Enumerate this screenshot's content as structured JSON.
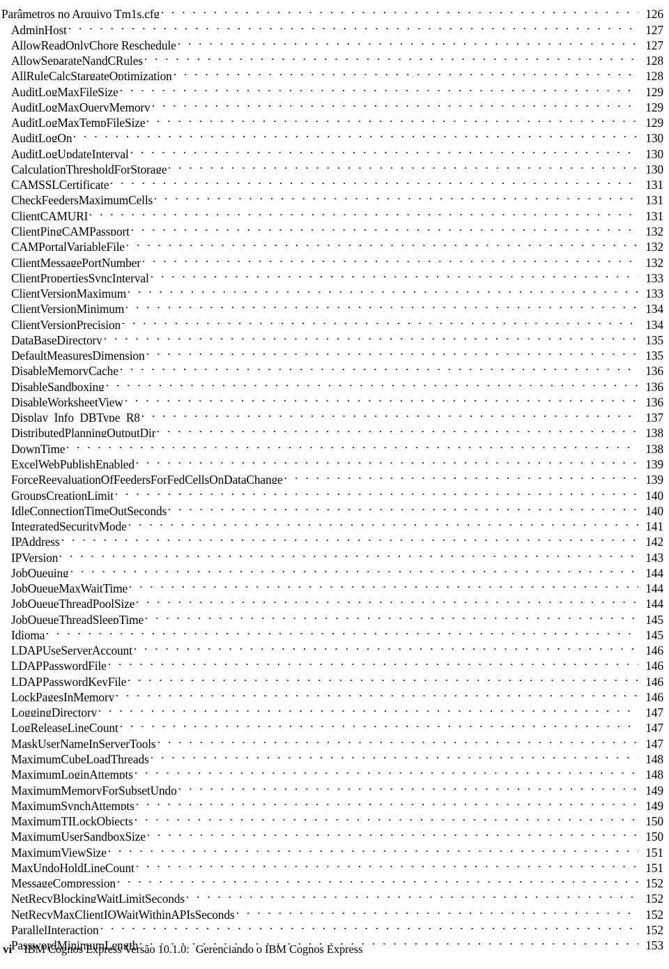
{
  "document": {
    "kind": "table-of-contents",
    "folio": "vi",
    "footer_product": "IBM Cognos Express Versão 10.1.0:",
    "footer_title": "Gerenciando o IBM Cognos Express"
  },
  "toc": {
    "entries": [
      {
        "title": "Parâmetros no Arquivo Tm1s.cfg",
        "page": "126",
        "level": 0
      },
      {
        "title": "AdminHost",
        "page": "127",
        "level": 1
      },
      {
        "title": "AllowReadOnlyChore Reschedule",
        "page": "127",
        "level": 1
      },
      {
        "title": "AllowSeparateNandCRules",
        "page": "128",
        "level": 1
      },
      {
        "title": "AllRuleCalcStargateOptimization",
        "page": "128",
        "level": 1
      },
      {
        "title": "AuditLogMaxFileSize",
        "page": "129",
        "level": 1
      },
      {
        "title": "AuditLogMaxQueryMemory",
        "page": "129",
        "level": 1
      },
      {
        "title": "AuditLogMaxTempFileSize",
        "page": "129",
        "level": 1
      },
      {
        "title": "AuditLogOn",
        "page": "130",
        "level": 1
      },
      {
        "title": "AuditLogUpdateInterval",
        "page": "130",
        "level": 1
      },
      {
        "title": "CalculationThresholdForStorage",
        "page": "130",
        "level": 1
      },
      {
        "title": "CAMSSLCertificate",
        "page": "131",
        "level": 1
      },
      {
        "title": "CheckFeedersMaximumCells",
        "page": "131",
        "level": 1
      },
      {
        "title": "ClientCAMURI",
        "page": "131",
        "level": 1
      },
      {
        "title": "ClientPingCAMPassport",
        "page": "132",
        "level": 1
      },
      {
        "title": "CAMPortalVariableFile",
        "page": "132",
        "level": 1
      },
      {
        "title": "ClientMessagePortNumber",
        "page": "132",
        "level": 1
      },
      {
        "title": "ClientPropertiesSyncInterval",
        "page": "133",
        "level": 1
      },
      {
        "title": "ClientVersionMaximum",
        "page": "133",
        "level": 1
      },
      {
        "title": "ClientVersionMinimum",
        "page": "134",
        "level": 1
      },
      {
        "title": "ClientVersionPrecision",
        "page": "134",
        "level": 1
      },
      {
        "title": "DataBaseDirectory",
        "page": "135",
        "level": 1
      },
      {
        "title": "DefaultMeasuresDimension",
        "page": "135",
        "level": 1
      },
      {
        "title": "DisableMemoryCache",
        "page": "136",
        "level": 1
      },
      {
        "title": "DisableSandboxing",
        "page": "136",
        "level": 1
      },
      {
        "title": "DisableWorksheetView",
        "page": "136",
        "level": 1
      },
      {
        "title": "Display_Info_DBType_R8",
        "page": "137",
        "level": 1
      },
      {
        "title": "DistributedPlanningOutputDir",
        "page": "138",
        "level": 1
      },
      {
        "title": "DownTime",
        "page": "138",
        "level": 1
      },
      {
        "title": "ExcelWebPublishEnabled",
        "page": "139",
        "level": 1
      },
      {
        "title": "ForceReevaluationOfFeedersForFedCellsOnDataChange",
        "page": "139",
        "level": 1
      },
      {
        "title": "GroupsCreationLimit",
        "page": "140",
        "level": 1
      },
      {
        "title": "IdleConnectionTimeOutSeconds",
        "page": "140",
        "level": 1
      },
      {
        "title": "IntegratedSecurityMode",
        "page": "141",
        "level": 1
      },
      {
        "title": "IPAddress",
        "page": "142",
        "level": 1
      },
      {
        "title": "IPVersion",
        "page": "143",
        "level": 1
      },
      {
        "title": "JobQueuing",
        "page": "144",
        "level": 1
      },
      {
        "title": "JobQueueMaxWaitTime",
        "page": "144",
        "level": 1
      },
      {
        "title": "JobQueueThreadPoolSize",
        "page": "144",
        "level": 1
      },
      {
        "title": "JobQueueThreadSleepTime",
        "page": "145",
        "level": 1
      },
      {
        "title": "Idioma",
        "page": "145",
        "level": 1
      },
      {
        "title": "LDAPUseServerAccount",
        "page": "146",
        "level": 1
      },
      {
        "title": "LDAPPasswordFile",
        "page": "146",
        "level": 1
      },
      {
        "title": "LDAPPasswordKeyFile",
        "page": "146",
        "level": 1
      },
      {
        "title": "LockPagesInMemory",
        "page": "146",
        "level": 1
      },
      {
        "title": "LoggingDirectory",
        "page": "147",
        "level": 1
      },
      {
        "title": "LogReleaseLineCount",
        "page": "147",
        "level": 1
      },
      {
        "title": "MaskUserNameInServerTools",
        "page": "147",
        "level": 1
      },
      {
        "title": "MaximumCubeLoadThreads",
        "page": "148",
        "level": 1
      },
      {
        "title": "MaximumLoginAttempts",
        "page": "148",
        "level": 1
      },
      {
        "title": "MaximumMemoryForSubsetUndo",
        "page": "149",
        "level": 1
      },
      {
        "title": "MaximumSynchAttempts",
        "page": "149",
        "level": 1
      },
      {
        "title": "MaximumTILockObjects",
        "page": "150",
        "level": 1
      },
      {
        "title": "MaximumUserSandboxSize",
        "page": "150",
        "level": 1
      },
      {
        "title": "MaximumViewSize",
        "page": "151",
        "level": 1
      },
      {
        "title": "MaxUndoHoldLineCount",
        "page": "151",
        "level": 1
      },
      {
        "title": "MessageCompression",
        "page": "152",
        "level": 1
      },
      {
        "title": "NetRecvBlockingWaitLimitSeconds",
        "page": "152",
        "level": 1
      },
      {
        "title": "NetRecvMaxClientIOWaitWithinAPIsSeconds",
        "page": "152",
        "level": 1
      },
      {
        "title": "ParallelInteraction",
        "page": "152",
        "level": 1
      },
      {
        "title": "PasswordMinimumLength",
        "page": "153",
        "level": 1
      }
    ]
  }
}
